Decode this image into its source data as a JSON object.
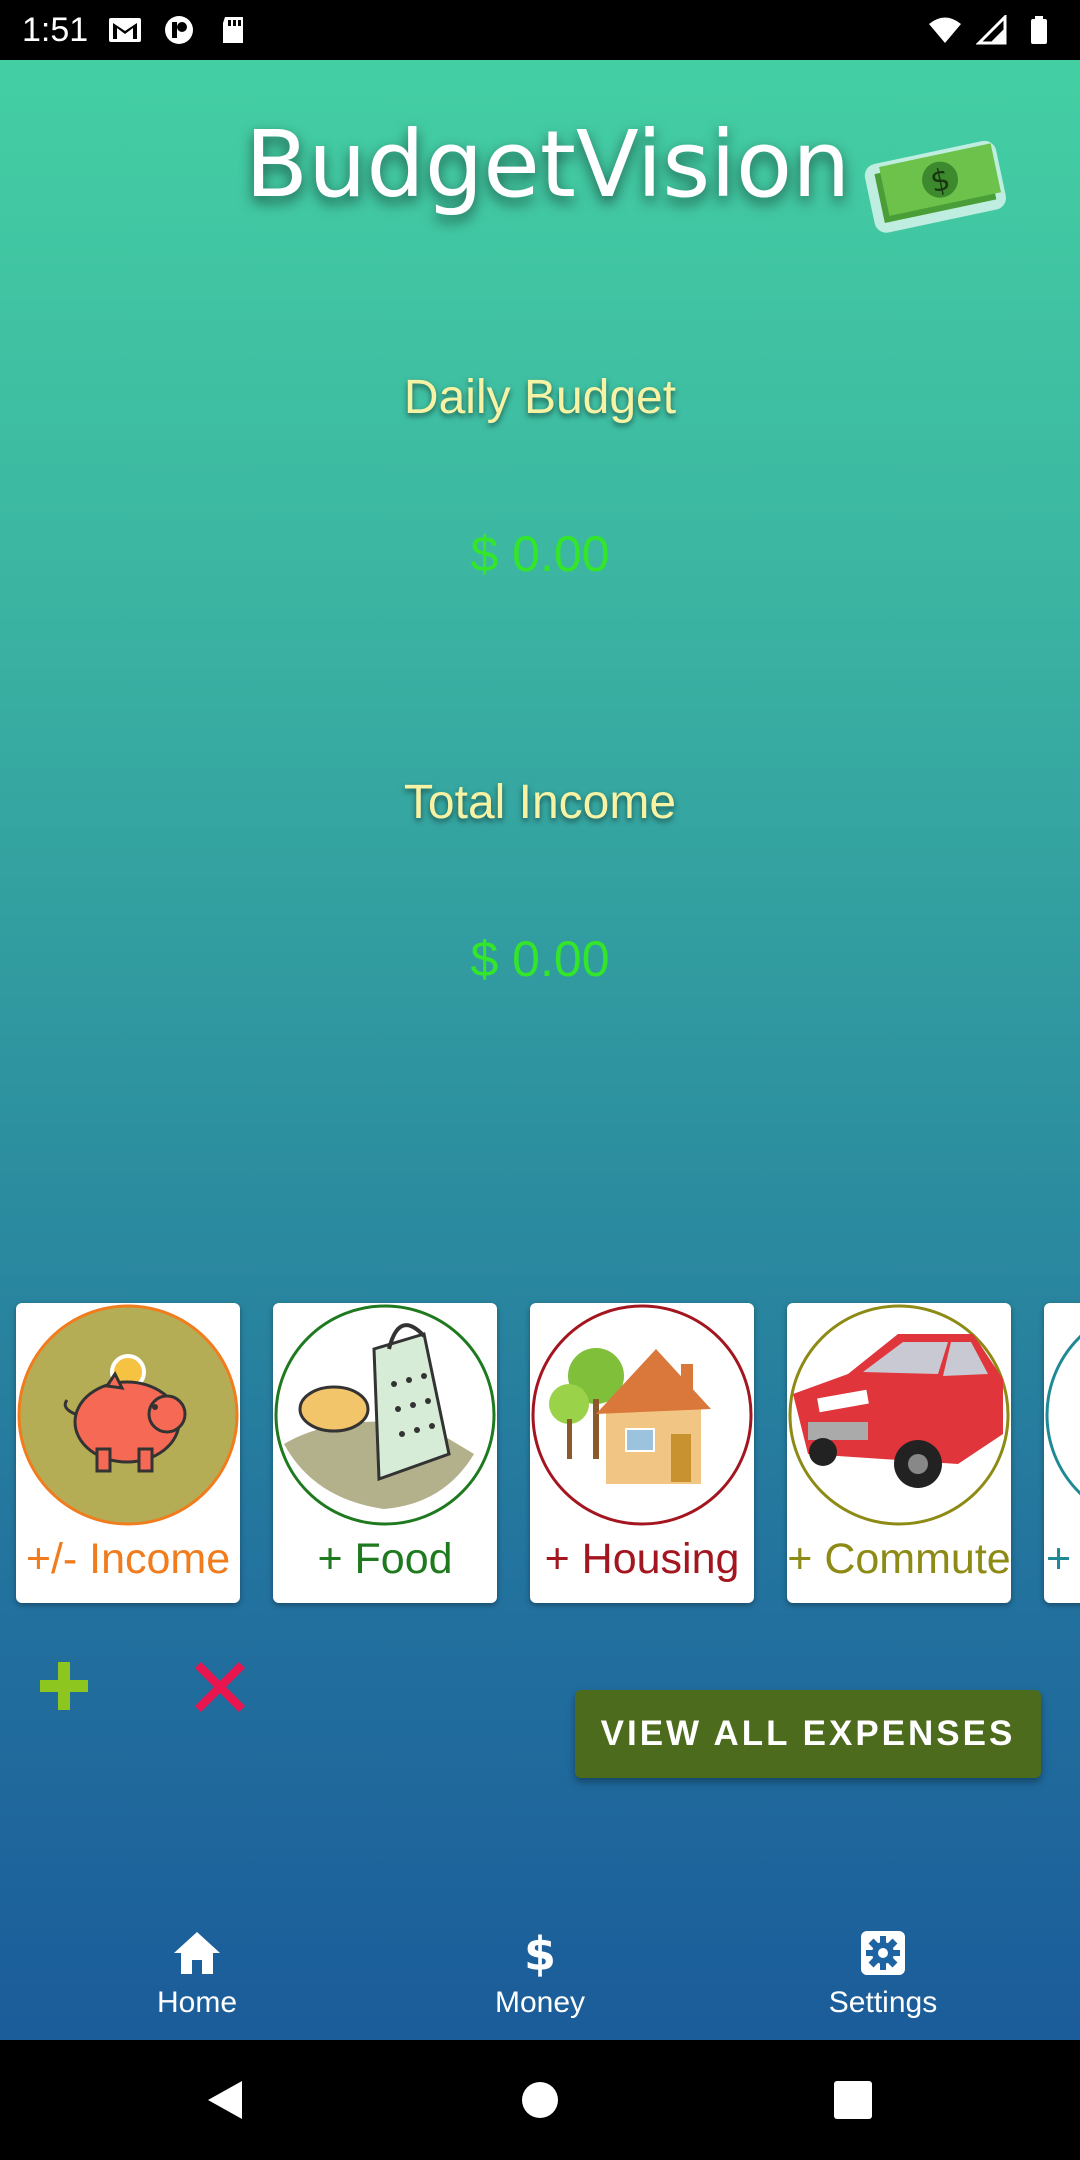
{
  "status_bar": {
    "time": "1:51",
    "left_icons": [
      "gmail-icon",
      "info-icon",
      "sd-card-icon"
    ],
    "right_icons": [
      "wifi-icon",
      "cell-signal-icon",
      "battery-icon"
    ]
  },
  "app": {
    "title": "BudgetVision",
    "logo_icon": "money-bill-icon"
  },
  "daily_budget": {
    "label": "Daily Budget",
    "value": "$ 0.00"
  },
  "total_income": {
    "label": "Total Income",
    "value": "$ 0.00"
  },
  "categories": [
    {
      "label": "+/- Income",
      "icon": "piggy-bank-icon",
      "color": "#f07c1e"
    },
    {
      "label": "+ Food",
      "icon": "grater-icon",
      "color": "#1f7a1f"
    },
    {
      "label": "+ Housing",
      "icon": "house-icon",
      "color": "#a3161f"
    },
    {
      "label": "+ Commute",
      "icon": "car-icon",
      "color": "#8d8a15"
    },
    {
      "label": "+",
      "icon": "partial-icon",
      "color": "#1f8a95"
    }
  ],
  "actions": {
    "add_icon": "plus-icon",
    "remove_icon": "close-icon",
    "view_all_label": "VIEW ALL EXPENSES"
  },
  "bottom_nav": {
    "items": [
      {
        "label": "Home",
        "icon": "home-icon"
      },
      {
        "label": "Money",
        "icon": "dollar-icon"
      },
      {
        "label": "Settings",
        "icon": "gear-icon"
      }
    ]
  },
  "system_nav": [
    "back-icon",
    "home-circle-icon",
    "recents-icon"
  ],
  "colors": {
    "gradient_top": "#44cfa3",
    "gradient_bottom": "#1b5c9a",
    "label_yellow": "#f7f3a4",
    "value_green": "#33e62a",
    "button_green": "#4c6b1c"
  }
}
